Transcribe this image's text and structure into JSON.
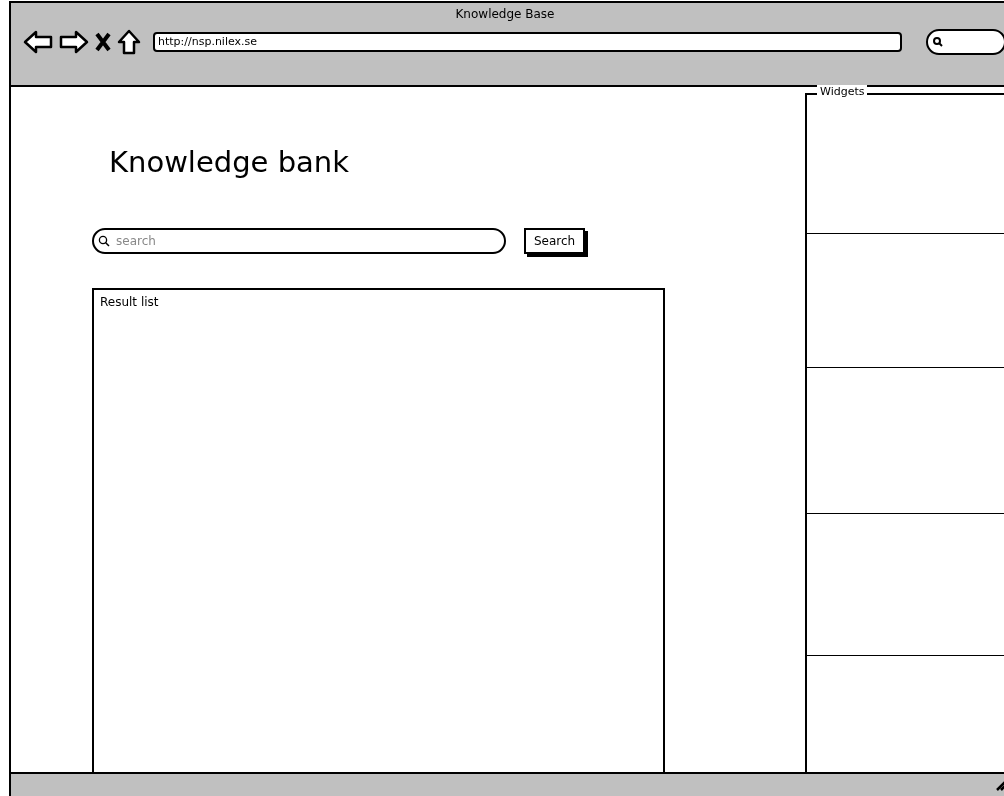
{
  "window": {
    "title": "Knowledge Base"
  },
  "address_bar": {
    "value": "http://nsp.nilex.se"
  },
  "page": {
    "heading": "Knowledge bank",
    "search": {
      "placeholder": "search",
      "button": "Search"
    },
    "result_list": {
      "label": "Result list"
    }
  },
  "widgets": {
    "title": "Widgets"
  }
}
